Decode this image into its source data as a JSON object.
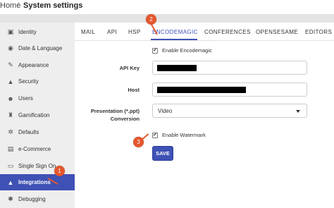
{
  "breadcrumb": {
    "home": "Home",
    "separator": "/",
    "current": "System settings"
  },
  "sidebar": {
    "items": [
      {
        "label": "Identity",
        "icon": "id-card-icon",
        "glyph": "▣"
      },
      {
        "label": "Date & Language",
        "icon": "globe-icon",
        "glyph": "◉"
      },
      {
        "label": "Appearance",
        "icon": "brush-icon",
        "glyph": "✎"
      },
      {
        "label": "Security",
        "icon": "lock-icon",
        "glyph": "▲"
      },
      {
        "label": "Users",
        "icon": "users-icon",
        "glyph": "☻"
      },
      {
        "label": "Gamification",
        "icon": "trophy-icon",
        "glyph": "♜"
      },
      {
        "label": "Defaults",
        "icon": "cogs-icon",
        "glyph": "✲"
      },
      {
        "label": "e-Commerce",
        "icon": "cart-icon",
        "glyph": "▤"
      },
      {
        "label": "Single Sign On",
        "icon": "sign-in-icon",
        "glyph": "▭"
      },
      {
        "label": "Integrations",
        "icon": "flask-icon",
        "glyph": "▲"
      },
      {
        "label": "Debugging",
        "icon": "bug-icon",
        "glyph": "✱"
      }
    ],
    "active_index": 9
  },
  "tabs": [
    "MAIL",
    "API",
    "HSP",
    "ENCODEMAGIC",
    "CONFERENCES",
    "OPENSESAME",
    "EDITORS"
  ],
  "active_tab": "ENCODEMAGIC",
  "form": {
    "enable_checkbox": {
      "label": "Enable Encodemagic",
      "checked": true,
      "mark": "✔"
    },
    "api_key": {
      "label": "API Key",
      "value": ""
    },
    "host": {
      "label": "Host",
      "value": ""
    },
    "presentation": {
      "label_line1": "Presentation (*.ppt)",
      "label_line2": "Conversion",
      "selected": "Video"
    },
    "watermark_checkbox": {
      "label": "Enable Watermark",
      "checked": true,
      "mark": "✔"
    },
    "save_label": "SAVE"
  },
  "callouts": [
    "1",
    "2",
    "3"
  ],
  "colors": {
    "accent": "#3f51b5",
    "callout": "#e4572e"
  }
}
